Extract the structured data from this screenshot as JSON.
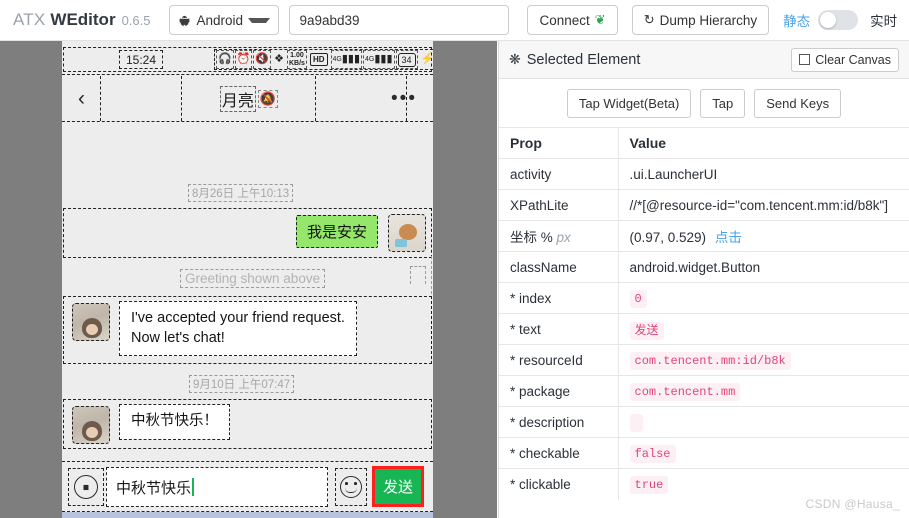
{
  "topbar": {
    "brand_prefix": "ATX",
    "brand_name": "WEditor",
    "version": "0.6.5",
    "device_select": {
      "label": "Android",
      "icon": "android-icon",
      "caret": "▾"
    },
    "serial_value": "9a9abd39",
    "serial_placeholder": "",
    "connect_label": "Connect",
    "connect_icon": "leaf-icon",
    "dump_label": "Dump Hierarchy",
    "dump_icon": "refresh-icon",
    "mode_static_label": "静态",
    "mode_live_label": "实时",
    "toggle_state": "off"
  },
  "phone": {
    "status_bar": {
      "time": "15:24",
      "icons": [
        "headphone-icon",
        "alarm-icon",
        "mute-icon",
        "bluetooth-icon"
      ],
      "net_speed": "1.00",
      "net_speed_unit": "KB/s",
      "hd_label": "HD",
      "signal1": "4G",
      "signal2": "4G",
      "battery": "34",
      "charging_icon": "bolt-icon"
    },
    "nav": {
      "back_icon": "chevron-left-icon",
      "title": "月亮",
      "mute_icon": "bell-mute-icon",
      "more_icon": "more-dots-icon",
      "more_glyph": "•••"
    },
    "chat": {
      "timestamp_1": "8月26日 上午10:13",
      "outgoing_message": "我是安安",
      "greeting_hint": "Greeting shown above",
      "incoming_message_1": "I've accepted your friend request.\nNow let's chat!",
      "timestamp_2": "9月10日 上午07:47",
      "incoming_message_2": "中秋节快乐！"
    },
    "input_bar": {
      "voice_icon": "voice-icon",
      "text_value": "中秋节快乐",
      "emoji_icon": "emoji-icon",
      "send_label": "发送"
    }
  },
  "panel": {
    "header_title": "Selected Element",
    "header_icon": "target-icon",
    "clear_canvas_label": "Clear Canvas",
    "actions": [
      "Tap Widget(Beta)",
      "Tap",
      "Send Keys"
    ],
    "columns": [
      "Prop",
      "Value"
    ],
    "rows": [
      {
        "prop": "activity",
        "value": ".ui.LauncherUI",
        "style": "plain"
      },
      {
        "prop": "XPathLite",
        "value": "//*[@resource-id=\"com.tencent.mm:id/b8k\"]",
        "style": "plain"
      },
      {
        "prop": "坐标",
        "value": "(0.97, 0.529)",
        "style": "coord",
        "unit_pct": "%",
        "unit_px": "px",
        "link": "点击"
      },
      {
        "prop": "className",
        "value": "android.widget.Button",
        "style": "plain"
      },
      {
        "prop": "* index",
        "value": "0",
        "style": "code"
      },
      {
        "prop": "* text",
        "value": "发送",
        "style": "code"
      },
      {
        "prop": "* resourceId",
        "value": "com.tencent.mm:id/b8k",
        "style": "code"
      },
      {
        "prop": "* package",
        "value": "com.tencent.mm",
        "style": "code"
      },
      {
        "prop": "* description",
        "value": "",
        "style": "code"
      },
      {
        "prop": "* checkable",
        "value": "false",
        "style": "code"
      },
      {
        "prop": "* clickable",
        "value": "true",
        "style": "code"
      }
    ],
    "watermark": "CSDN @Hausa_"
  },
  "colors": {
    "accent_blue": "#4aa3e8",
    "wechat_green": "#95e76b",
    "send_green": "#18b554",
    "highlight_red": "#ff1f1f",
    "code_pink": "#e0457b"
  }
}
